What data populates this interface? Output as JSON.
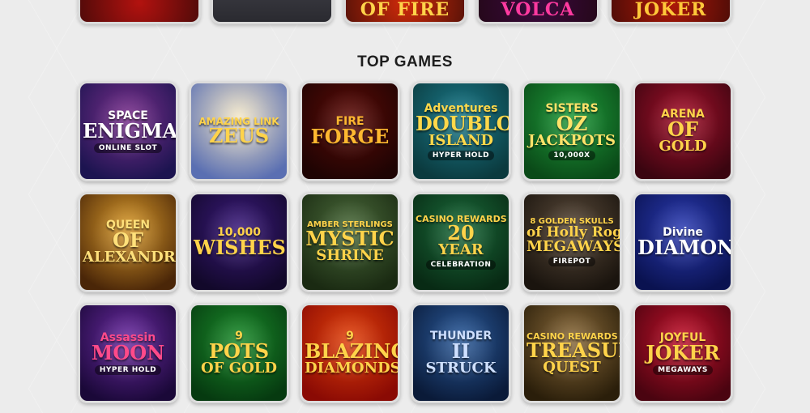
{
  "top_row": [
    {
      "text": "",
      "bg": "#b3120f"
    },
    {
      "text": "",
      "bg": "#6e6e78"
    },
    {
      "text": "OF FIRE",
      "bg": "#d02a0a",
      "color": "#ffd34a"
    },
    {
      "text": "VOLCA",
      "bg": "#3a0a3e",
      "color": "#ff3aa0"
    },
    {
      "text": "JOKER",
      "bg": "#b01808",
      "color": "#ffc83a"
    }
  ],
  "section": {
    "title": "TOP GAMES"
  },
  "games": [
    {
      "name": "space-enigma",
      "l1": "SPACE",
      "l2": "ENIGMA",
      "l3": "",
      "badge": "ONLINE SLOT",
      "bg1": "#7a2f8c",
      "bg2": "#1c1450",
      "color": "#ffffff"
    },
    {
      "name": "amazing-link-zeus",
      "l1": "AMAZING LINK",
      "l2": "ZEUS",
      "l3": "",
      "badge": "",
      "bg1": "#f3e7c8",
      "bg2": "#5a6fb2",
      "color": "#ffd34a"
    },
    {
      "name": "fire-forge",
      "l1": "FIRE",
      "l2": "FORGE",
      "l3": "",
      "badge": "",
      "bg1": "#5a0a06",
      "bg2": "#1e0403",
      "color": "#ffb830"
    },
    {
      "name": "doubloon-island",
      "l1": "Adventures",
      "l2": "DOUBLOON",
      "l3": "ISLAND",
      "badge": "HYPER HOLD",
      "bg1": "#1a7a8a",
      "bg2": "#0b3a3e",
      "color": "#ffd84a"
    },
    {
      "name": "sisters-of-oz-jackpots",
      "l1": "SISTERS",
      "l2": "OZ",
      "l3": "JACKPOTS",
      "badge": "10,000X",
      "bg1": "#1f9a3a",
      "bg2": "#0a4a18",
      "color": "#ffe36a"
    },
    {
      "name": "arena-of-gold",
      "l1": "ARENA",
      "l2": "OF",
      "l3": "GOLD",
      "badge": "",
      "bg1": "#a4102a",
      "bg2": "#3a0510",
      "color": "#ffd34a"
    },
    {
      "name": "queen-of-alexandria",
      "l1": "QUEEN",
      "l2": "OF",
      "l3": "ALEXANDRIA",
      "badge": "",
      "bg1": "#d99a2a",
      "bg2": "#4a2608",
      "color": "#ffe07a"
    },
    {
      "name": "10000-wishes",
      "l1": "10,000",
      "l2": "WISHES",
      "l3": "",
      "badge": "",
      "bg1": "#3a1a7a",
      "bg2": "#12082a",
      "color": "#ffd34a"
    },
    {
      "name": "mystic-shrine",
      "l1": "AMBER STERLINGS",
      "l2": "MYSTIC",
      "l3": "SHRINE",
      "badge": "",
      "bg1": "#4a6a3a",
      "bg2": "#1a2a12",
      "color": "#ffd34a"
    },
    {
      "name": "20-year-celebration",
      "l1": "CASINO REWARDS",
      "l2": "20",
      "l3": "YEAR",
      "badge": "CELEBRATION",
      "bg1": "#1a6a3a",
      "bg2": "#082a14",
      "color": "#ffd34a"
    },
    {
      "name": "8-golden-skulls",
      "l1": "8 GOLDEN SKULLS",
      "l2": "of Holly Roger",
      "l3": "MEGAWAYS",
      "badge": "FIREPOT",
      "bg1": "#5a4a3a",
      "bg2": "#1a140e",
      "color": "#ffd34a"
    },
    {
      "name": "divine-diamonds",
      "l1": "Divine",
      "l2": "DIAMONDS",
      "l3": "",
      "badge": "",
      "bg1": "#2a3ab0",
      "bg2": "#0a1250",
      "color": "#ffffff"
    },
    {
      "name": "assassin-moon",
      "l1": "Assassin",
      "l2": "MOON",
      "l3": "",
      "badge": "HYPER HOLD",
      "bg1": "#6a2aa0",
      "bg2": "#1a0838",
      "color": "#ff4a8a"
    },
    {
      "name": "9-pots-of-gold",
      "l1": "9",
      "l2": "POTS",
      "l3": "OF GOLD",
      "badge": "",
      "bg1": "#1a8a2a",
      "bg2": "#063a10",
      "color": "#ffd34a"
    },
    {
      "name": "9-blazing-diamonds",
      "l1": "9",
      "l2": "BLAZING",
      "l3": "DIAMONDS",
      "badge": "",
      "bg1": "#e0400a",
      "bg2": "#8a0a04",
      "color": "#ffd34a"
    },
    {
      "name": "thunderstruck-ii",
      "l1": "THUNDER",
      "l2": "II",
      "l3": "STRUCK",
      "badge": "",
      "bg1": "#2a5a9a",
      "bg2": "#0a1a38",
      "color": "#cfe0ff"
    },
    {
      "name": "treasure-quest",
      "l1": "CASINO REWARDS",
      "l2": "TREASURE",
      "l3": "QUEST",
      "badge": "",
      "bg1": "#8a6a3a",
      "bg2": "#2a1e0a",
      "color": "#ffd34a"
    },
    {
      "name": "joyful-joker-megaways",
      "l1": "JOYFUL",
      "l2": "JOKER",
      "l3": "",
      "badge": "MEGAWAYS",
      "bg1": "#c0102a",
      "bg2": "#4a0410",
      "color": "#ffd34a"
    }
  ]
}
